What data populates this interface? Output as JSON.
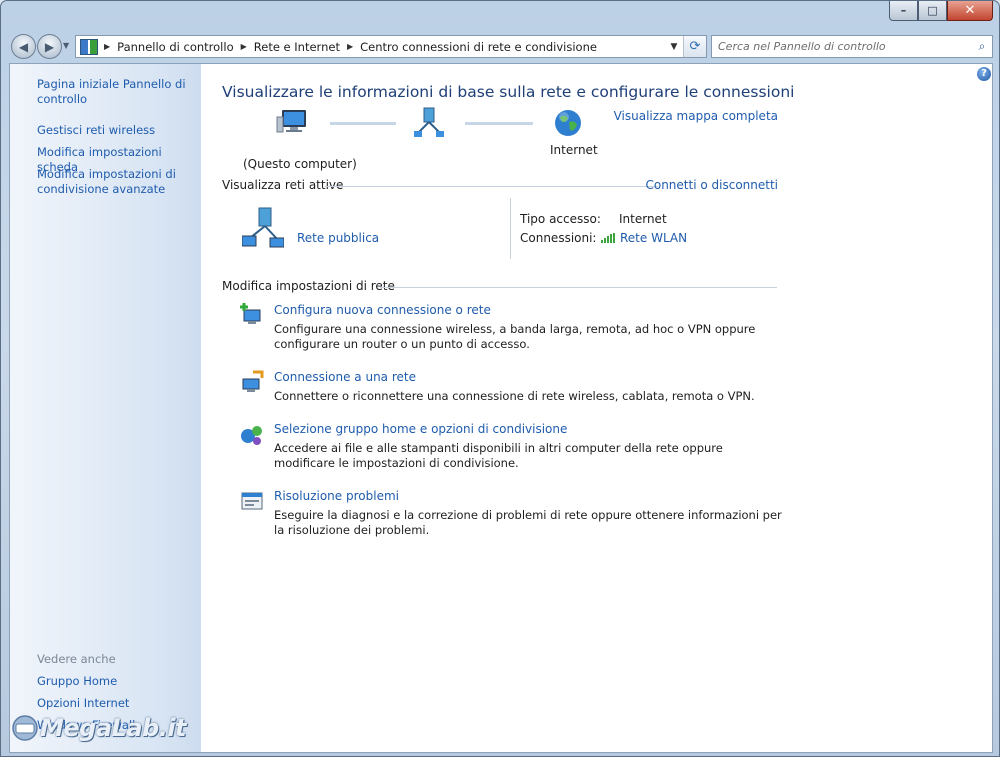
{
  "window": {
    "min_label": "–",
    "max_label": "□",
    "close_label": "✕"
  },
  "nav": {
    "breadcrumbs": [
      "Pannello di controllo",
      "Rete e Internet",
      "Centro connessioni di rete e condivisione"
    ],
    "search_placeholder": "Cerca nel Pannello di controllo"
  },
  "sidebar": {
    "home_link": "Pagina iniziale Pannello di controllo",
    "links": [
      "Gestisci reti wireless",
      "Modifica impostazioni scheda",
      "Modifica impostazioni di condivisione avanzate"
    ],
    "see_also_heading": "Vedere anche",
    "see_also": [
      "Gruppo Home",
      "Opzioni Internet",
      "Windows Firewall"
    ],
    "watermark": "MegaLab.it"
  },
  "main": {
    "help_label": "?",
    "title": "Visualizzare le informazioni di base sulla rete e configurare le connessioni",
    "view_map_link": "Visualizza mappa completa",
    "computer_label": "(Questo computer)",
    "internet_label": "Internet",
    "active_networks_heading": "Visualizza reti attive",
    "connect_disconnect_link": "Connetti o disconnetti",
    "network_name": "Rete pubblica",
    "access_type_label": "Tipo accesso:",
    "access_type_value": "Internet",
    "connections_label": "Connessioni:",
    "connections_value": "Rete WLAN",
    "change_settings_heading": "Modifica impostazioni di rete",
    "tasks": [
      {
        "title": "Configura nuova connessione o rete",
        "desc": "Configurare una connessione wireless, a banda larga, remota, ad hoc o VPN oppure configurare un router o un punto di accesso."
      },
      {
        "title": "Connessione a una rete",
        "desc": "Connettere o riconnettere una connessione di rete wireless, cablata, remota o VPN."
      },
      {
        "title": "Selezione gruppo home e opzioni di condivisione",
        "desc": "Accedere ai file e alle stampanti disponibili in altri computer della rete oppure modificare le impostazioni di condivisione."
      },
      {
        "title": "Risoluzione problemi",
        "desc": "Eseguire la diagnosi e la correzione di problemi di rete oppure ottenere informazioni per la risoluzione dei problemi."
      }
    ]
  }
}
